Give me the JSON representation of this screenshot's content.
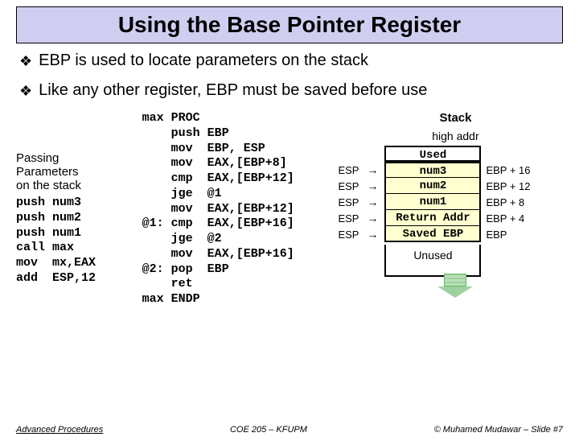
{
  "title": "Using the Base Pointer Register",
  "bullets": [
    "EBP is used to locate parameters on the stack",
    "Like any other register, EBP must be saved before use"
  ],
  "left": {
    "desc1": "Passing",
    "desc2": "Parameters",
    "desc3": "on the stack",
    "code": "push num3\npush num2\npush num1\ncall max\nmov  mx,EAX\nadd  ESP,12"
  },
  "proc_code": "max PROC\n    push EBP\n    mov  EBP, ESP\n    mov  EAX,[EBP+8]\n    cmp  EAX,[EBP+12]\n    jge  @1\n    mov  EAX,[EBP+12]\n@1: cmp  EAX,[EBP+16]\n    jge  @2\n    mov  EAX,[EBP+16]\n@2: pop  EBP\n    ret\nmax ENDP",
  "stack": {
    "title": "Stack",
    "high": "high addr",
    "rows": [
      {
        "esp": "",
        "cell": "Used",
        "off": "",
        "cls": "used first"
      },
      {
        "esp": "ESP",
        "cell": "num3",
        "off": "EBP + 16",
        "cls": "first"
      },
      {
        "esp": "ESP",
        "cell": "num2",
        "off": "EBP + 12",
        "cls": ""
      },
      {
        "esp": "ESP",
        "cell": "num1",
        "off": "EBP + 8",
        "cls": ""
      },
      {
        "esp": "ESP",
        "cell": "Return Addr",
        "off": "EBP + 4",
        "cls": ""
      },
      {
        "esp": "ESP",
        "cell": "Saved EBP",
        "off": "EBP",
        "cls": "last"
      }
    ],
    "unused": "Unused"
  },
  "footer": {
    "left": "Advanced Procedures",
    "center": "COE 205 – KFUPM",
    "right": "© Muhamed Mudawar – Slide #7"
  }
}
